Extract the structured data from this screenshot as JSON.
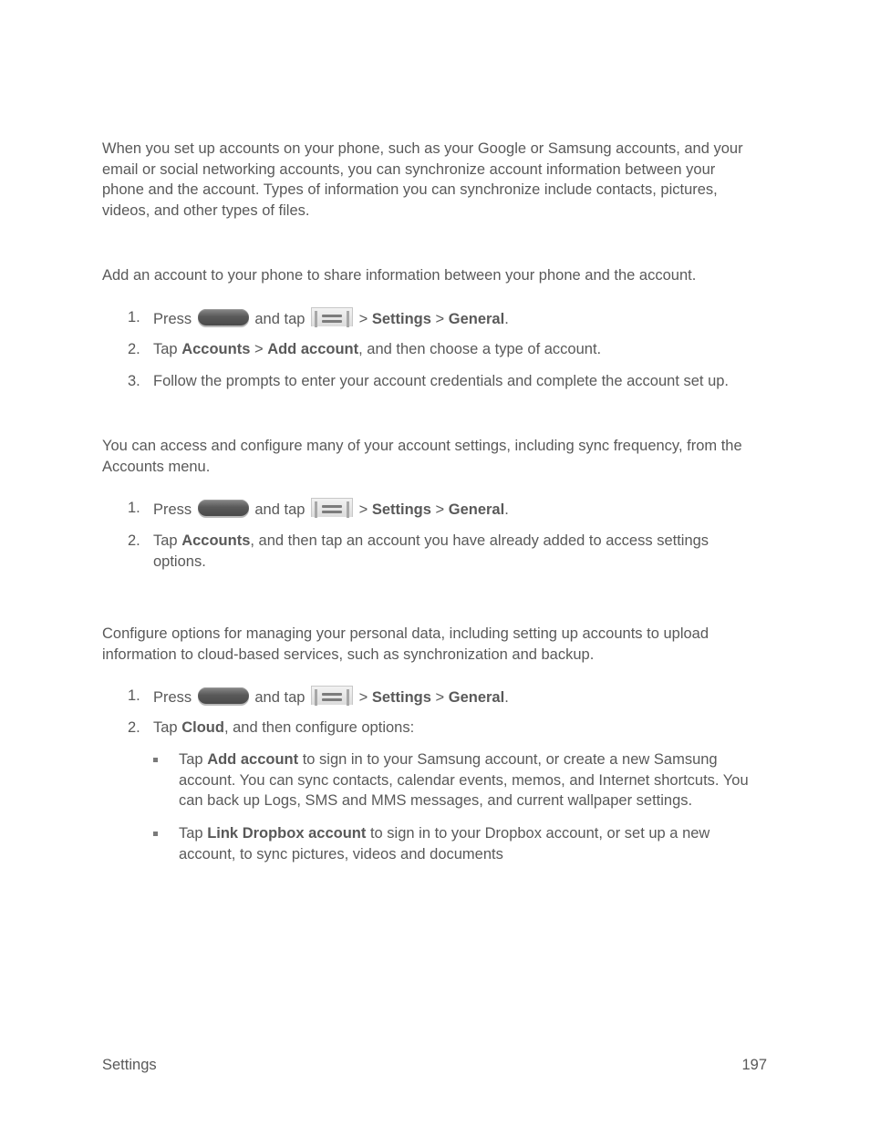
{
  "intro": {
    "text": "When you set up accounts on your phone, such as your Google or Samsung accounts, and your email or social networking accounts, you can synchronize account information between your phone and the account. Types of information you can synchronize include contacts, pictures, videos, and other types of files."
  },
  "add_account": {
    "intro": "Add an account to your phone to share information between your phone and the account.",
    "steps": [
      {
        "num": "1.",
        "press": "Press",
        "and_tap": "and tap",
        "sep1": " > ",
        "b1": "Settings",
        "sep2": " > ",
        "b2": "General",
        "end": "."
      },
      {
        "num": "2.",
        "pre": "Tap ",
        "b1": "Accounts",
        "sep": " > ",
        "b2": "Add account",
        "post": ", and then choose a type of account."
      },
      {
        "num": "3.",
        "text": "Follow the prompts to enter your account credentials and complete the account set up."
      }
    ]
  },
  "account_settings": {
    "intro": "You can access and configure many of your account settings, including sync frequency, from the Accounts menu.",
    "steps": [
      {
        "num": "1.",
        "press": "Press",
        "and_tap": "and tap",
        "sep1": " > ",
        "b1": "Settings",
        "sep2": " > ",
        "b2": "General",
        "end": "."
      },
      {
        "num": "2.",
        "pre": "Tap ",
        "b1": "Accounts",
        "post": ", and then tap an account you have already added to access settings options."
      }
    ]
  },
  "cloud": {
    "intro": "Configure options for managing your personal data, including setting up accounts to upload information to cloud-based services, such as synchronization and backup.",
    "steps": [
      {
        "num": "1.",
        "press": "Press",
        "and_tap": "and tap",
        "sep1": " > ",
        "b1": "Settings",
        "sep2": " > ",
        "b2": "General",
        "end": "."
      },
      {
        "num": "2.",
        "pre": "Tap ",
        "b1": "Cloud",
        "post": ", and then configure options:"
      }
    ],
    "bullets": [
      {
        "pre": "Tap ",
        "b": "Add account",
        "post": " to sign in to your Samsung account, or create a new Samsung account. You can sync contacts, calendar events, memos, and Internet shortcuts. You can back up Logs, SMS and MMS messages, and current wallpaper settings."
      },
      {
        "pre": "Tap ",
        "b": "Link Dropbox account",
        "post": " to sign in to your Dropbox account, or set up a new account, to sync pictures, videos and documents"
      }
    ]
  },
  "icons": {
    "home": "home-key-icon",
    "menu": "menu-key-icon"
  },
  "footer": {
    "section": "Settings",
    "page": "197"
  }
}
